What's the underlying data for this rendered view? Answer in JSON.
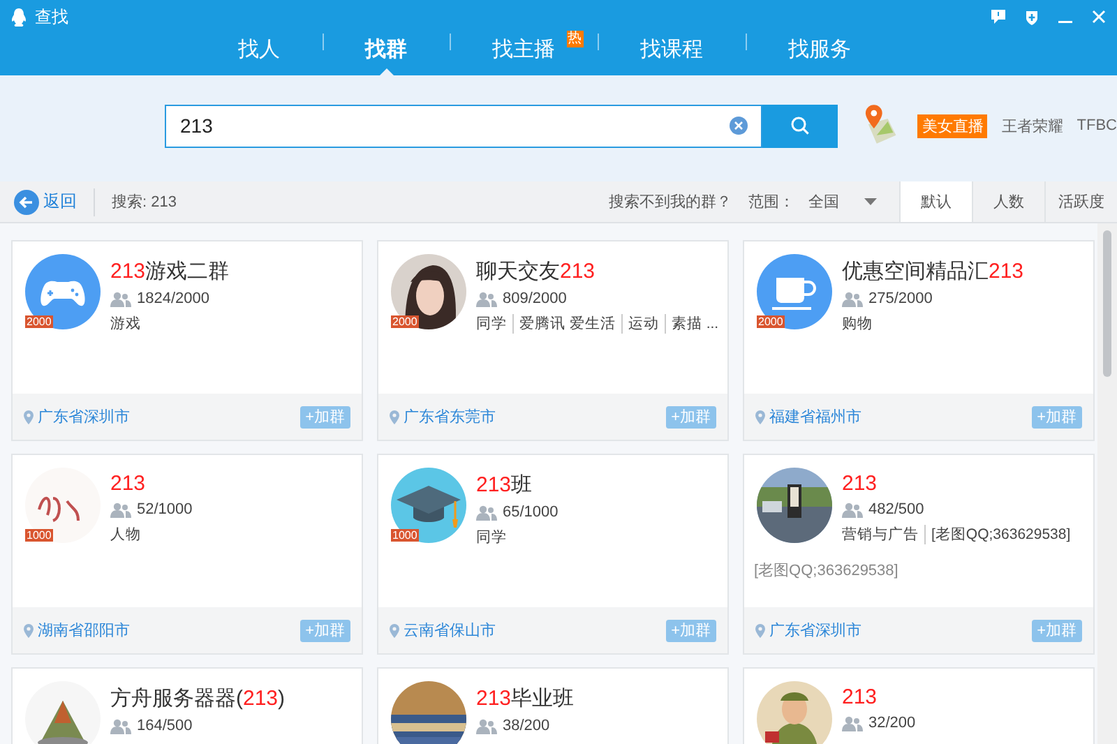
{
  "window": {
    "title": "查找"
  },
  "tabs": [
    {
      "label": "找人",
      "selected": false
    },
    {
      "label": "找群",
      "selected": true
    },
    {
      "label": "找主播",
      "selected": false,
      "badge": "热"
    },
    {
      "label": "找课程",
      "selected": false
    },
    {
      "label": "找服务",
      "selected": false
    }
  ],
  "search": {
    "value": "213"
  },
  "quick_links": [
    {
      "label": "美女直播",
      "kind": "highlight"
    },
    {
      "label": "王者荣耀",
      "kind": "plain"
    },
    {
      "label": "TFBC",
      "kind": "plain"
    }
  ],
  "toolbar": {
    "back": "返回",
    "query": "搜索: 213",
    "help_link": "搜索不到我的群？",
    "range_label": "范围：",
    "range_value": "全国",
    "sort_tabs": [
      {
        "label": "默认",
        "selected": true
      },
      {
        "label": "人数",
        "selected": false
      },
      {
        "label": "活跃度",
        "selected": false
      }
    ]
  },
  "groups": [
    {
      "avatar": {
        "kind": "gamepad"
      },
      "level_badge": "2000",
      "title": [
        {
          "text": "213",
          "match": true
        },
        {
          "text": "游戏二群",
          "match": false
        }
      ],
      "members": "1824/2000",
      "tags": [
        "游戏"
      ],
      "location": "广东省深圳市",
      "join": "+加群"
    },
    {
      "avatar": {
        "kind": "picture"
      },
      "level_badge": "2000",
      "title": [
        {
          "text": "聊天交友",
          "match": false
        },
        {
          "text": "213",
          "match": true
        }
      ],
      "members": "809/2000",
      "tags": [
        "同学",
        "爱腾讯 爱生活",
        "运动",
        "素描 ..."
      ],
      "location": "广东省东莞市",
      "join": "+加群"
    },
    {
      "avatar": {
        "kind": "cup"
      },
      "level_badge": "2000",
      "title": [
        {
          "text": "优惠空间精品汇",
          "match": false
        },
        {
          "text": "213",
          "match": true
        }
      ],
      "members": "275/2000",
      "tags": [
        "购物"
      ],
      "location": "福建省福州市",
      "join": "+加群"
    },
    {
      "avatar": {
        "kind": "picture"
      },
      "level_badge": "1000",
      "title": [
        {
          "text": "213",
          "match": true
        }
      ],
      "members": "52/1000",
      "tags": [
        "人物"
      ],
      "location": "湖南省邵阳市",
      "join": "+加群"
    },
    {
      "avatar": {
        "kind": "cap"
      },
      "level_badge": "1000",
      "title": [
        {
          "text": "213",
          "match": true
        },
        {
          "text": "班",
          "match": false
        }
      ],
      "members": "65/1000",
      "tags": [
        "同学"
      ],
      "location": "云南省保山市",
      "join": "+加群"
    },
    {
      "avatar": {
        "kind": "picture"
      },
      "title": [
        {
          "text": "213",
          "match": true
        }
      ],
      "members": "482/500",
      "tags": [
        "营销与广告",
        "[老图QQ;363629538]"
      ],
      "description": "[老图QQ;363629538]",
      "location": "广东省深圳市",
      "join": "+加群"
    },
    {
      "avatar": {
        "kind": "picture"
      },
      "title": [
        {
          "text": "方舟服务器器(",
          "match": false
        },
        {
          "text": "213",
          "match": true
        },
        {
          "text": ")",
          "match": false
        }
      ],
      "members": "164/500"
    },
    {
      "avatar": {
        "kind": "picture"
      },
      "title": [
        {
          "text": "213",
          "match": true
        },
        {
          "text": "毕业班",
          "match": false
        }
      ],
      "members": "38/200"
    },
    {
      "avatar": {
        "kind": "picture"
      },
      "title": [
        {
          "text": "213",
          "match": true
        }
      ],
      "members": "32/200"
    }
  ]
}
